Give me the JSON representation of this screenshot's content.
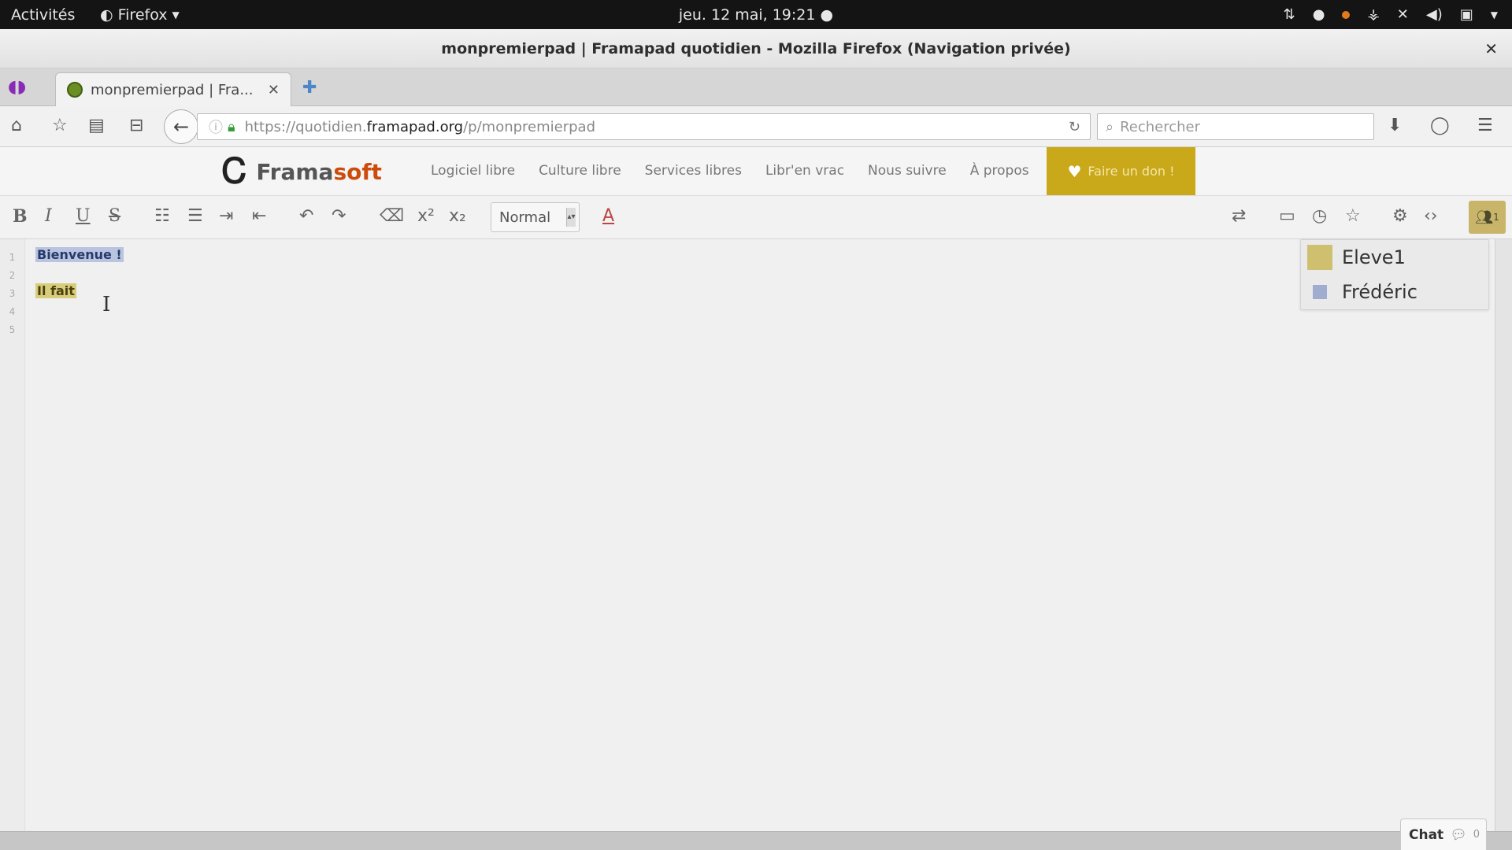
{
  "os": {
    "activities": "Activités",
    "app_name": "Firefox",
    "clock": "jeu. 12 mai, 19:21 ●"
  },
  "window": {
    "title": "monpremierpad | Framapad quotidien - Mozilla Firefox (Navigation privée)",
    "close": "✕"
  },
  "tabs": [
    {
      "label": "monpremierpad | Fra...",
      "close": "✕"
    }
  ],
  "newtab": "✚",
  "navbar": {
    "url_prefix": "https://quotidien.",
    "url_domain": "framapad.org",
    "url_suffix": "/p/monpremierpad",
    "search_placeholder": "Rechercher"
  },
  "framasoft": {
    "brand_part1": "Frama",
    "brand_part2": "soft",
    "menu": [
      "Logiciel libre",
      "Culture libre",
      "Services libres",
      "Libr'en vrac",
      "Nous suivre",
      "À propos"
    ],
    "donate": "Faire un don !"
  },
  "toolbar": {
    "bold": "B",
    "italic": "I",
    "underline": "U",
    "strike": "S",
    "style_select": "Normal",
    "font_color": "A",
    "users_count": "1"
  },
  "editor": {
    "line_numbers": [
      "1",
      "2",
      "3",
      "4",
      "5"
    ],
    "lines": [
      {
        "text": "Bienvenue !",
        "author": "Frédéric"
      },
      {
        "text": "",
        "author": ""
      },
      {
        "text": "Il fait",
        "author": "Eleve1"
      }
    ]
  },
  "users": [
    {
      "name": "Eleve1",
      "color": "#cfc070"
    },
    {
      "name": "Frédéric",
      "color": "#a0acd0"
    }
  ],
  "chat": {
    "label": "Chat",
    "count": "0"
  },
  "colors": {
    "framasoft_orange": "#cc4c0c",
    "donate_bg": "#c9a81a",
    "author_eleve1": "#d7cd7a",
    "author_frederic": "#b8c4e0"
  }
}
